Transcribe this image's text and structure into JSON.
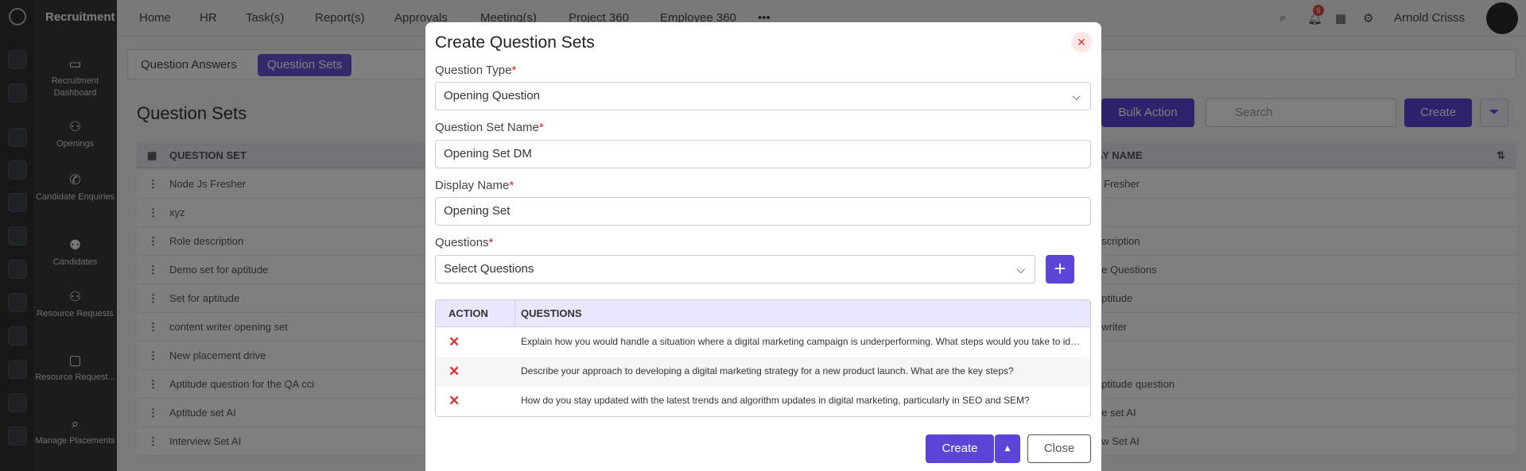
{
  "app": {
    "name": "Recruitment"
  },
  "topnav": [
    "HOME_PLACEHOLDER"
  ],
  "top_nav_items": [
    "Home",
    "HR",
    "Task(s)",
    "Report(s)",
    "Approvals",
    "Meeting(s)",
    "Project 360",
    "Employee 360"
  ],
  "user": {
    "name": "Arnold Crisss",
    "notification_count": "6"
  },
  "sidebar": {
    "items": [
      {
        "label": "Recruitment Dashboard",
        "icon": "dashboard-icon"
      },
      {
        "label": "Openings",
        "icon": "openings-icon"
      },
      {
        "label": "Candidate Enquiries",
        "icon": "phone-icon"
      },
      {
        "label": "Candidates",
        "icon": "candidates-icon"
      },
      {
        "label": "Resource Requests",
        "icon": "resource-icon"
      },
      {
        "label": "Resource Request...",
        "icon": "resource-request-icon"
      },
      {
        "label": "Manage Placements",
        "icon": "placements-icon"
      }
    ]
  },
  "tabs": [
    "Question Answers",
    "Question Sets"
  ],
  "page": {
    "title": "Question Sets",
    "bulk_action": "Bulk Action",
    "search_placeholder": "Search",
    "create": "Create",
    "col_question_set": "QUESTION SET",
    "col_display_name": "AY NAME",
    "rows": [
      {
        "set": "Node Js Fresher",
        "display": "s Fresher"
      },
      {
        "set": "xyz",
        "display": ""
      },
      {
        "set": "Role description",
        "display": "escription"
      },
      {
        "set": "Demo set for aptitude",
        "display": "de Questions"
      },
      {
        "set": "Set for aptitude",
        "display": "aptitude"
      },
      {
        "set": "content writer opening set",
        "display": "t writer"
      },
      {
        "set": "New placement drive",
        "display": ""
      },
      {
        "set": "Aptitude question for the QA cci",
        "display": "aptitude question"
      },
      {
        "set": "Aptitude set AI",
        "display": "de set AI"
      },
      {
        "set": "Interview Set AI",
        "display": "ew Set AI"
      }
    ]
  },
  "modal": {
    "title": "Create Question Sets",
    "question_type_label": "Question Type",
    "question_type_value": "Opening Question",
    "question_set_name_label": "Question Set Name",
    "question_set_name_value": "Opening Set DM",
    "display_name_label": "Display Name",
    "display_name_value": "Opening Set",
    "questions_label": "Questions",
    "questions_placeholder": "Select Questions",
    "required_mark": "*",
    "table": {
      "col_action": "ACTION",
      "col_questions": "QUESTIONS",
      "rows": [
        "Explain how you would handle a situation where a digital marketing campaign is underperforming. What steps would you take to identify the problem?",
        "Describe your approach to developing a digital marketing strategy for a new product launch. What are the key steps?",
        "How do you stay updated with the latest trends and algorithm updates in digital marketing, particularly in SEO and SEM?"
      ]
    },
    "create_button": "Create",
    "close_button": "Close"
  },
  "colors": {
    "accent": "#5b45d6",
    "danger": "#d33333"
  }
}
